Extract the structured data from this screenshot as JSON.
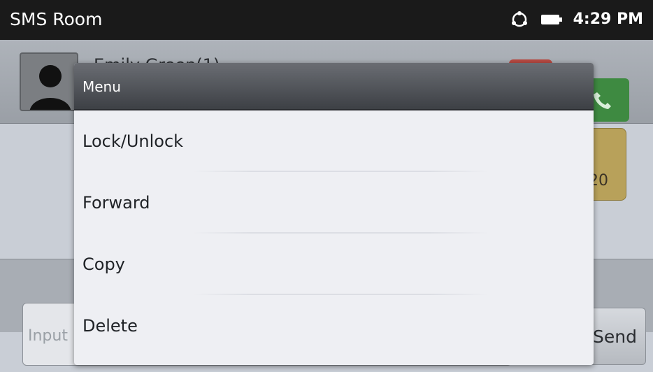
{
  "statusbar": {
    "title": "SMS Room",
    "time": "4:29 PM",
    "icons": [
      "sync-icon",
      "battery-icon"
    ]
  },
  "background": {
    "contact_name": "Emily Green(1)",
    "bubble_time": "20",
    "input_placeholder": "Input",
    "send_label": "Send"
  },
  "menu": {
    "title": "Menu",
    "items": [
      {
        "label": "Lock/Unlock"
      },
      {
        "label": "Forward"
      },
      {
        "label": "Copy"
      },
      {
        "label": "Delete"
      }
    ]
  },
  "colors": {
    "statusbar_bg": "#1a1a1a",
    "menu_header": "#4a4d52",
    "menu_bg": "#eeeff3",
    "call_green": "#3e8a41"
  }
}
